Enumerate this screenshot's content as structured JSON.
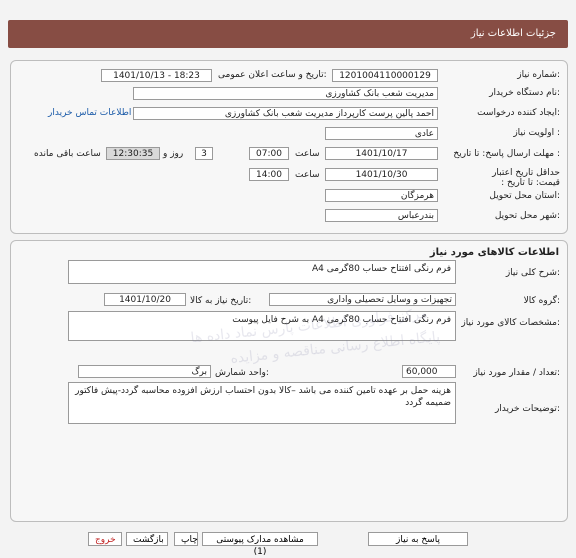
{
  "header": {
    "title": "جزئیات اطلاعات نیاز"
  },
  "info": {
    "need_number_label": "شماره نیاز:",
    "need_number": "1201004110000129",
    "announce_label": "تاریخ و ساعت اعلان عمومی:",
    "announce_value": "1401/10/13 - 18:23",
    "buyer_org_label": "نام دستگاه خریدار:",
    "buyer_org": "مدیریت شعب بانک کشاورزی",
    "creator_label": "ایجاد کننده درخواست:",
    "creator": "احمد پالین پرست  کارپرداز مدیریت شعب بانک کشاورزی",
    "contact_link": "اطلاعات تماس خریدار",
    "priority_label": "اولویت نیاز :",
    "priority": "عادی",
    "reply_deadline_label": "مهلت ارسال پاسخ: تا تاریخ :",
    "reply_date": "1401/10/17",
    "time_label": "ساعت",
    "reply_time": "07:00",
    "days_value": "3",
    "days_label": "روز و",
    "remaining_time": "12:30:35",
    "remaining_label": "ساعت باقی مانده",
    "min_price_label": "حداقل تاریخ اعتبار قیمت: تا تاریخ :",
    "price_date": "1401/10/30",
    "price_time": "14:00",
    "province_label": "استان محل تحویل:",
    "province": "هرمزگان",
    "city_label": "شهر محل تحویل:",
    "city": "بندرعباس"
  },
  "goods": {
    "title": "اطلاعات کالاهای مورد نیاز",
    "summary_label": "شرح کلی نیاز:",
    "summary": "فرم رنگی  افتتاح حساب  80گرمی A4",
    "group_label": "گروه کالا:",
    "group": "تجهیزات و وسایل تحصیلی واداری",
    "need_date_label": "تاریخ نیاز به کالا:",
    "need_date": "1401/10/20",
    "spec_label": "مشخصات کالای مورد نیاز:",
    "spec": "فرم رنگی  افتتاح حساب  80گرمی A4  به شرح فایل پیوست",
    "qty_label": "تعداد / مقدار مورد نیاز:",
    "qty": "60,000",
    "unit_label": "واحد شمارش:",
    "unit": "برگ",
    "notes_label": "توضیحات خریدار:",
    "notes": "هزینه حمل بر عهده تامین کننده می باشد –کالا بدون احتساب ارزش افزوده محاسبه گردد-پیش فاکتور ضمیمه گردد"
  },
  "buttons": {
    "reply": "پاسخ به نیاز",
    "attachments": "مشاهده مدارک پیوستی (1)",
    "print": "چاپ",
    "back": "بازگشت",
    "exit": "خروج"
  },
  "watermark": {
    "line1": "مرکز فراوری اطلاعات پارس نماد داده ها",
    "line2": "پایگاه اطلاع رسانی مناقصه و مزایده"
  }
}
